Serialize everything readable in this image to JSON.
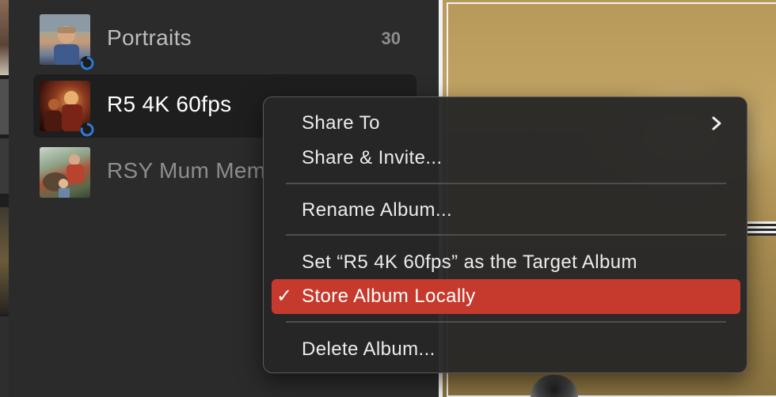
{
  "albums": [
    {
      "name": "Portraits",
      "count": "30",
      "name_color": "#bdbdbd",
      "thumb_icon": "portrait-thumbnail",
      "badge": "sync-icon"
    },
    {
      "name": "R5 4K 60fps",
      "name_color": "#ffffff",
      "selected": true,
      "thumb_icon": "video-thumbnail",
      "badge": "sync-icon"
    },
    {
      "name": "RSY Mum Mem",
      "name_color": "#8d8d8d",
      "thumb_icon": "family-thumbnail"
    }
  ],
  "context_menu": {
    "items": [
      {
        "label": "Share To",
        "has_submenu": true,
        "icon": "chevron-right-icon"
      },
      {
        "label": "Share & Invite..."
      },
      {
        "label": "Rename Album..."
      },
      {
        "label": "Set “R5 4K 60fps” as the Target Album"
      },
      {
        "label": "Store Album Locally",
        "checked": true,
        "highlighted": true,
        "check_glyph": "✓"
      },
      {
        "label": "Delete Album..."
      }
    ]
  },
  "colors": {
    "panel_bg": "#2b2b2b",
    "menu_bg": "#262626",
    "highlight": "#c53a2d",
    "sync_blue": "#2e7bd6"
  }
}
